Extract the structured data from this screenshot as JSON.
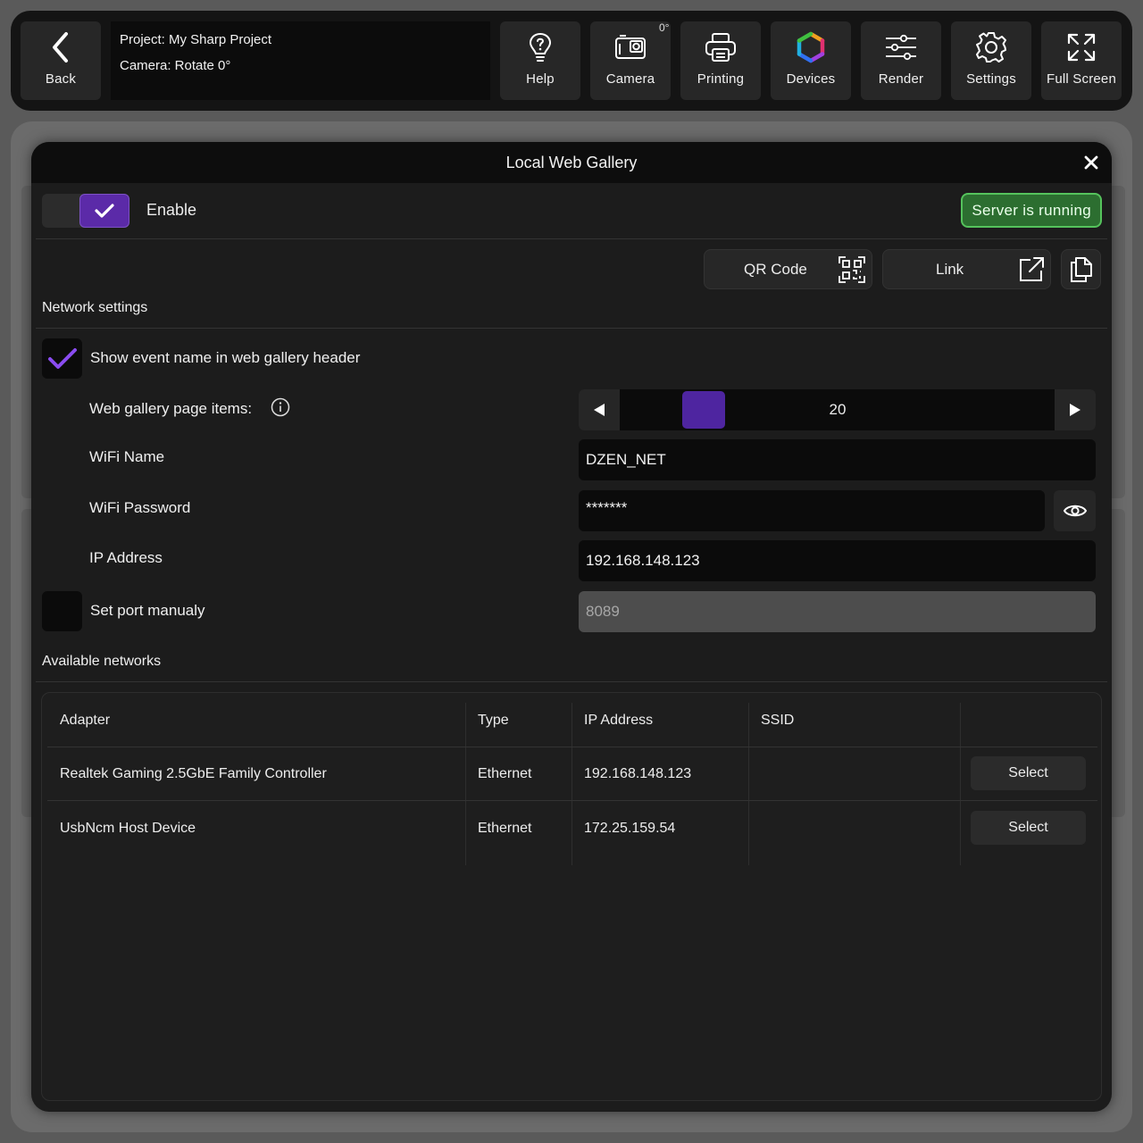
{
  "toolbar": {
    "back_label": "Back",
    "project_line": "Project: My Sharp Project",
    "camera_line": "Camera: Rotate 0°",
    "camera_rotation_badge": "0°",
    "help_label": "Help",
    "camera_label": "Camera",
    "printing_label": "Printing",
    "devices_label": "Devices",
    "render_label": "Render",
    "settings_label": "Settings",
    "fullscreen_label": "Full Screen"
  },
  "modal": {
    "title": "Local Web Gallery",
    "enable_label": "Enable",
    "enable_checked": true,
    "server_status": "Server is running",
    "qr_label": "QR Code",
    "link_label": "Link",
    "network_section": "Network settings",
    "show_event_label": "Show event name in web gallery header",
    "show_event_checked": true,
    "page_items_label": "Web gallery page items:",
    "page_items_value": "20",
    "wifi_name_label": "WiFi Name",
    "wifi_name_value": "DZEN_NET",
    "wifi_password_label": "WiFi Password",
    "wifi_password_value": "*******",
    "ip_label": "IP Address",
    "ip_value": "192.168.148.123",
    "port_label": "Set port manualy",
    "port_checked": false,
    "port_value": "8089",
    "networks_section": "Available networks"
  },
  "table": {
    "headers": [
      "Adapter",
      "Type",
      "IP Address",
      "SSID"
    ],
    "rows": [
      {
        "adapter": "Realtek Gaming 2.5GbE Family Controller",
        "type": "Ethernet",
        "ip": "192.168.148.123",
        "ssid": "",
        "action": "Select"
      },
      {
        "adapter": "UsbNcm Host Device",
        "type": "Ethernet",
        "ip": "172.25.159.54",
        "ssid": "",
        "action": "Select"
      }
    ]
  },
  "colors": {
    "accent": "#5b2aa8",
    "check": "#8a4cf0",
    "status_bg": "#2c6e30",
    "status_border": "#55c35c"
  }
}
